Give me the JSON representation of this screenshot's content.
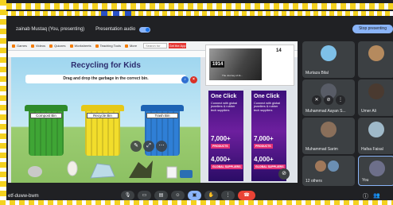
{
  "meeting": {
    "presenter_label": "zainab Mustaq (You, presenting)",
    "presentation_audio_label": "Presentation audio",
    "stop_button_label": "Stop presenting",
    "meeting_code": "etf-duww-bwm"
  },
  "browser_nav": {
    "items": [
      "Games",
      "Videos",
      "Quizzes",
      "Worksheets",
      "Teaching Tools",
      "More"
    ],
    "search_placeholder": "Search for",
    "get_app_label": "Get the App"
  },
  "game": {
    "title": "Recycling for Kids",
    "instruction": "Drag and drop the garbage in the correct bin.",
    "bins": [
      {
        "label": "Compost Bin",
        "color": "#3fa535",
        "lid_color": "#2e8b2b"
      },
      {
        "label": "Recycle Bin",
        "color": "#f2dd2b",
        "lid_color": "#e6c817"
      },
      {
        "label": "Trash Bin",
        "color": "#2f7fd6",
        "lid_color": "#1e63b4"
      }
    ]
  },
  "side_content": {
    "year": "1914",
    "page_number": "14",
    "photo_caption": "The Journey of Al...",
    "ads": [
      {
        "headline": "One Click",
        "subtext": "Connect with global jewellers & rubber tech suppliers",
        "stat1": "7,000+",
        "label1": "PRODUCTS",
        "stat2": "4,000+",
        "label2": "GLOBAL SUPPLIERS"
      },
      {
        "headline": "One Click",
        "subtext": "Connect with global jewellers & rubber tech suppliers",
        "stat1": "7,000+",
        "label1": "PRODUCTS",
        "stat2": "4,000+",
        "label2": "GLOBAL SUPPLIERS"
      }
    ]
  },
  "participants": [
    {
      "name": "Murtaza Bilal"
    },
    {
      "name": ""
    },
    {
      "name": "Muhammad Aayan S..."
    },
    {
      "name": "Umer Ali"
    },
    {
      "name": "Muhammad Sarim"
    },
    {
      "name": "Hafsa Faisal"
    },
    {
      "name": "12 others"
    },
    {
      "name": "You"
    }
  ],
  "colors": {
    "meet_background": "#202124",
    "tile_background": "#3c4043",
    "accent": "#8ab4f8",
    "end_call": "#ea4335",
    "highlight_border": "#f4d21f"
  }
}
